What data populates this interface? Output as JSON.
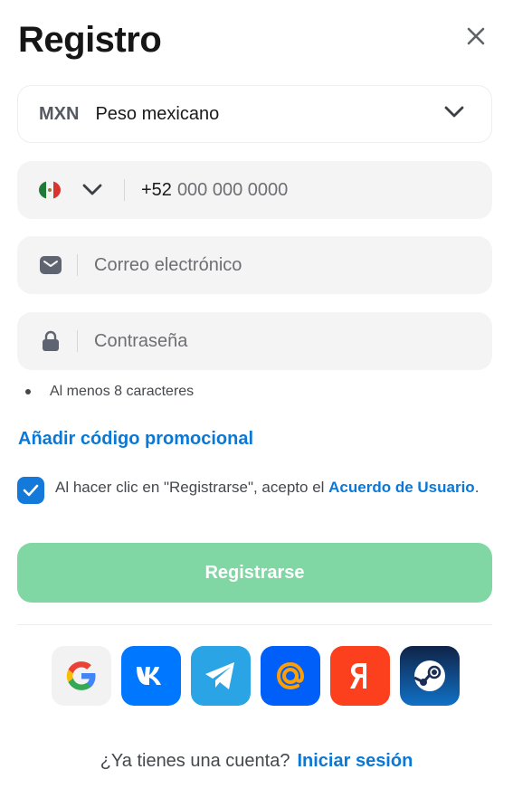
{
  "header": {
    "title": "Registro"
  },
  "currency": {
    "code": "MXN",
    "name": "Peso mexicano"
  },
  "phone": {
    "prefix": "+52",
    "placeholder": "000 000 0000"
  },
  "email": {
    "placeholder": "Correo electrónico"
  },
  "password": {
    "placeholder": "Contraseña",
    "hint": "Al menos 8 caracteres"
  },
  "promo": {
    "label": "Añadir código promocional"
  },
  "agreement": {
    "checked": true,
    "text": "Al hacer clic en \"Registrarse\", acepto el ",
    "link": "Acuerdo de Usuario",
    "suffix": "."
  },
  "register": {
    "label": "Registrarse"
  },
  "socials": [
    "google-icon",
    "vk-icon",
    "telegram-icon",
    "mail-ru-icon",
    "yandex-icon",
    "steam-icon"
  ],
  "colors": {
    "accent": "#0a78d6",
    "button": "#80d7a4",
    "checkbox": "#1479d9"
  },
  "footer": {
    "text": "¿Ya tienes una cuenta?",
    "link": "Iniciar sesión"
  }
}
